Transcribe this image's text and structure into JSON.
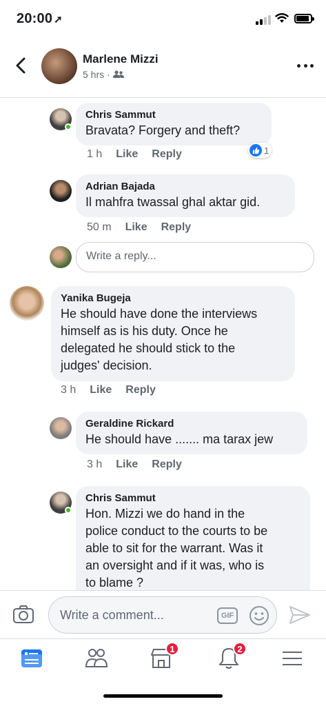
{
  "status_bar": {
    "time": "20:00"
  },
  "header": {
    "name": "Marlene Mizzi",
    "time": "5 hrs",
    "separator": "·"
  },
  "comments": [
    {
      "author": "Chris Sammut",
      "text": "Bravata? Forgery and theft?",
      "time": "1 h",
      "like_label": "Like",
      "reply_label": "Reply",
      "reaction_count": "1",
      "online": true
    },
    {
      "author": "Adrian Bajada",
      "text": "Il mahfra twassal ghal aktar gid.",
      "time": "50 m",
      "like_label": "Like",
      "reply_label": "Reply"
    },
    {
      "reply_placeholder": "Write a reply..."
    },
    {
      "author": "Yanika Bugeja",
      "text_lines": [
        "He should have done the interviews",
        "himself as is his duty. Once he",
        "delegated he should stick to the",
        "judges' decision."
      ],
      "time": "3 h",
      "like_label": "Like",
      "reply_label": "Reply"
    },
    {
      "author": "Geraldine Rickard",
      "text": "He should have ....... ma tarax jew",
      "time": "3 h",
      "like_label": "Like",
      "reply_label": "Reply"
    },
    {
      "author": "Chris Sammut",
      "text_lines": [
        "Hon. Mizzi we do hand in the",
        "police conduct to the courts to be",
        "able to sit for the warrant. Was it",
        "an oversight and if it was, who is",
        "to blame ?"
      ],
      "online": true
    }
  ],
  "composer": {
    "placeholder": "Write a comment...",
    "gif_label": "GIF"
  },
  "tabbar": {
    "marketplace_badge": "1",
    "notifications_badge": "2"
  },
  "colors": {
    "accent": "#1877f2",
    "bubble": "#f0f2f5",
    "badge": "#e41e3f",
    "online": "#42b72a"
  }
}
